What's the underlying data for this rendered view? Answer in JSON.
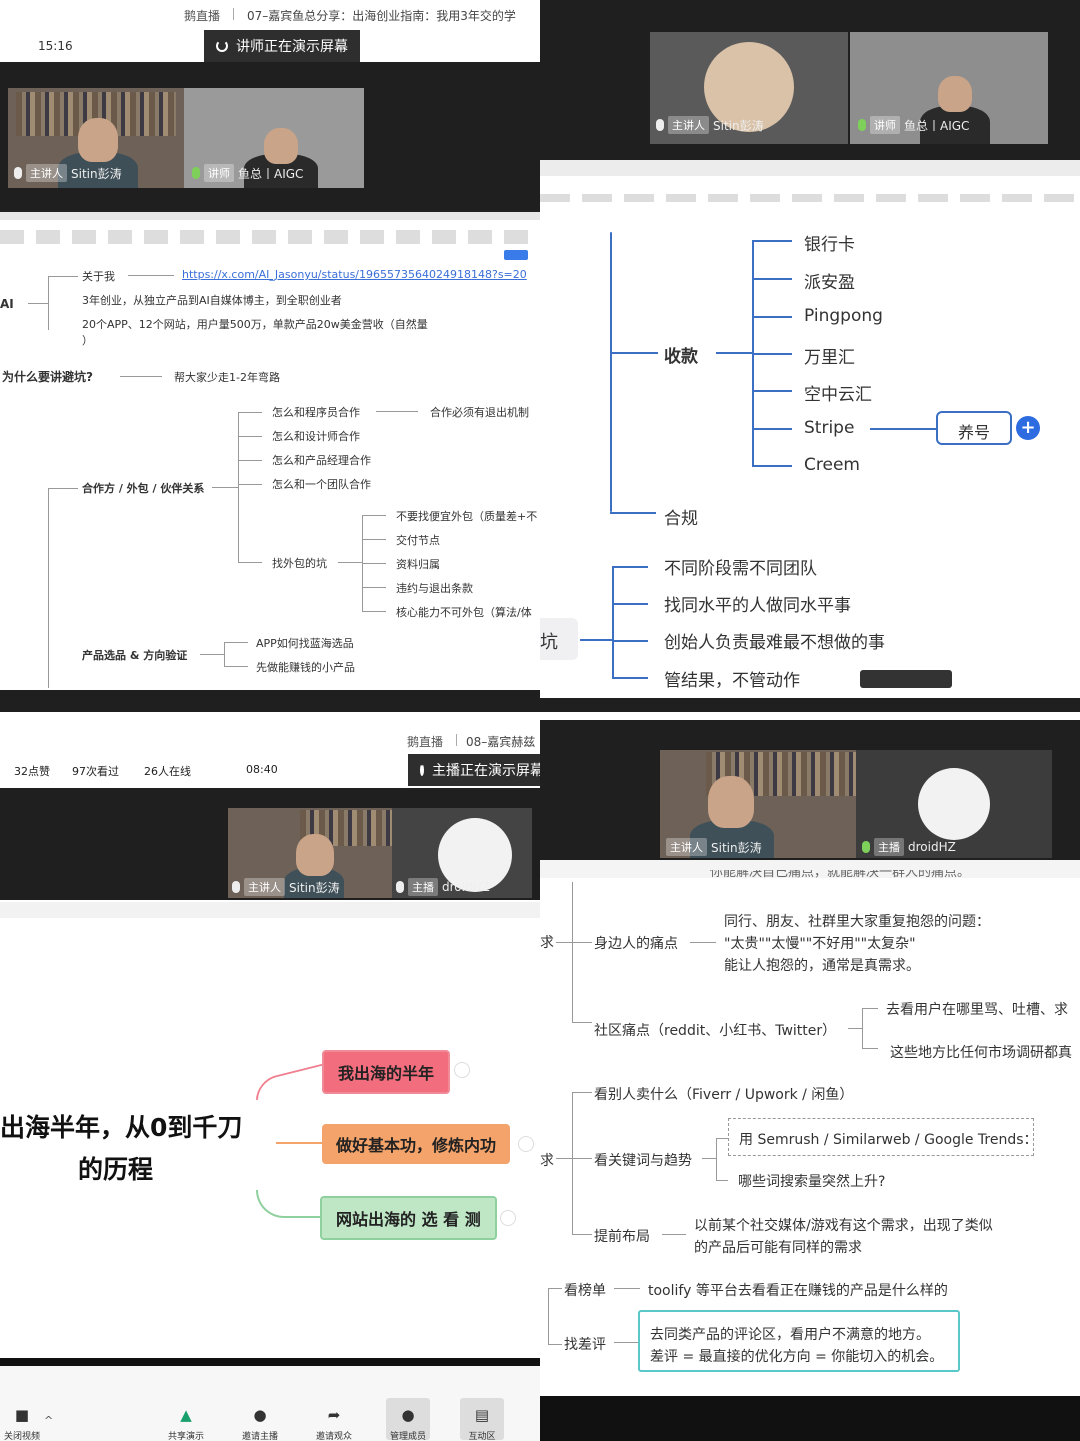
{
  "p1": {
    "header_platform": "鹅直播",
    "header_title": "07–嘉宾鱼总分享：出海创业指南：我用3年交的学",
    "clock": "15:16",
    "presenting": "讲师正在演示屏幕",
    "host_role": "主讲人",
    "host_name": "Sitin彭涛",
    "guest_role": "讲师",
    "guest_name": "鱼总丨AIGC",
    "mindmap": {
      "root_partial": "AI",
      "about_label": "关于我",
      "about_link": "https://x.com/AI_Jasonyu/status/1965573564024918148?s=20",
      "about_line1": "3年创业，从独立产品到AI自媒体博主，到全职创业者",
      "about_line2": "20个APP、12个网站，用户量500万，单款产品20w美金营收（自然量",
      "about_line2b": "）",
      "why_label": "为什么要讲避坑?",
      "why_value": "帮大家少走1-2年弯路",
      "coop_label": "合作方 / 外包 / 伙伴关系",
      "coop_items": [
        "怎么和程序员合作",
        "怎么和设计师合作",
        "怎么和产品经理合作",
        "怎么和一个团队合作"
      ],
      "coop_note": "合作必须有退出机制",
      "outsource_label": "找外包的坑",
      "outsource_items": [
        "不要找便宜外包（质量差+不",
        "交付节点",
        "资料归属",
        "违约与退出条款",
        "核心能力不可外包（算法/体"
      ],
      "product_label": "产品选品 & 方向验证",
      "product_items": [
        "APP如何找蓝海选品",
        "先做能赚钱的小产品"
      ]
    }
  },
  "p2": {
    "host_role": "主讲人",
    "host_name": "Sitin彭涛",
    "guest_role": "讲师",
    "guest_name": "鱼总丨AIGC",
    "collect_label": "收款",
    "collect_items": [
      "银行卡",
      "派安盈",
      "Pingpong",
      "万里汇",
      "空中云汇",
      "Stripe",
      "Creem"
    ],
    "stripe_child": "养号",
    "plus": "+",
    "compliance_label": "合规",
    "pit_partial": "坑",
    "team_items": [
      "不同阶段需不同团队",
      "找同水平的人做同水平事",
      "创始人负责最难最不想做的事",
      "管结果，不管动作"
    ]
  },
  "p3": {
    "header_platform": "鹅直播",
    "header_title": "08–嘉宾赫兹",
    "likes": "32点赞",
    "views": "97次看过",
    "online": "26人在线",
    "clock": "08:40",
    "presenting": "主播正在演示屏幕",
    "host_role": "主讲人",
    "host_name": "Sitin彭涛",
    "guest_role": "主播",
    "guest_name": "droidHZ",
    "main_title_line1": "出海半年，从0到千刀",
    "main_title_line2": "的历程",
    "branch1": "我出海的半年",
    "branch2": "做好基本功，修炼内功",
    "branch3": "网站出海的 选 看 测",
    "toolbar": [
      {
        "label": "关闭视频",
        "icon": "■"
      },
      {
        "label": "共享演示",
        "icon": "▲"
      },
      {
        "label": "邀请主播",
        "icon": "●"
      },
      {
        "label": "邀请观众",
        "icon": "➦"
      },
      {
        "label": "管理成员",
        "icon": "●"
      },
      {
        "label": "互动区",
        "icon": "▤"
      }
    ],
    "colors": {
      "branch1_bg": "#f26d7d",
      "branch2_bg": "#f4a36a",
      "branch3_bg": "#bfe7c6"
    }
  },
  "p4": {
    "host_role": "主讲人",
    "host_name": "Sitin彭涛",
    "guest_role": "主播",
    "guest_name": "droidHZ",
    "cut_text": "你能解决自己痛点，就能解决一群人的痛点。",
    "left_partial_1": "求",
    "left_partial_2": "求",
    "pain_label": "身边人的痛点",
    "pain_line1": "同行、朋友、社群里大家重复抱怨的问题：",
    "pain_line2": "\"太贵\"\"太慢\"\"不好用\"\"太复杂\"",
    "pain_line3": "能让人抱怨的，通常是真需求。",
    "community_label": "社区痛点（reddit、小红书、Twitter）",
    "community_item1": "去看用户在哪里骂、吐槽、求",
    "community_item2": "这些地方比任何市场调研都真",
    "sell_label": "看别人卖什么（Fiverr / Upwork / 闲鱼）",
    "keyword_label": "看关键词与趋势",
    "keyword_tool": "用 Semrush / Similarweb / Google Trends：",
    "keyword_q": "哪些词搜索量突然上升?",
    "early_label": "提前布局",
    "early_line1": "以前某个社交媒体/游戏有这个需求，出现了类似",
    "early_line2": "的产品后可能有同样的需求",
    "rank_label": "看榜单",
    "rank_value": "toolify 等平台去看看正在赚钱的产品是什么样的",
    "bad_label": "找差评",
    "bad_line1": "去同类产品的评论区，看用户不满意的地方。",
    "bad_line2": "差评 = 最直接的优化方向 = 你能切入的机会。"
  }
}
